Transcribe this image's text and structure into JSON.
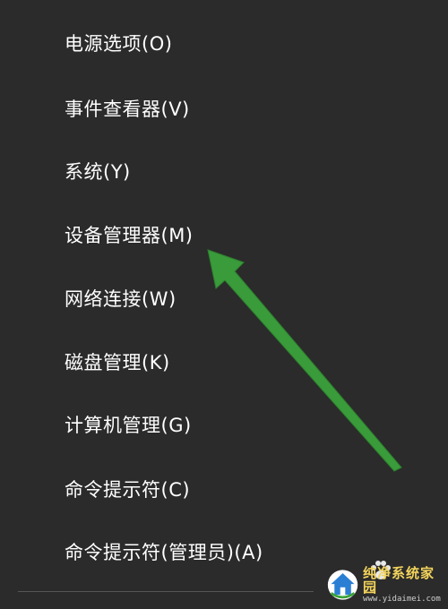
{
  "menu": {
    "items": [
      {
        "label": "电源选项(O)"
      },
      {
        "label": "事件查看器(V)"
      },
      {
        "label": "系统(Y)"
      },
      {
        "label": "设备管理器(M)"
      },
      {
        "label": "网络连接(W)"
      },
      {
        "label": "磁盘管理(K)"
      },
      {
        "label": "计算机管理(G)"
      },
      {
        "label": "命令提示符(C)"
      },
      {
        "label": "命令提示符(管理员)(A)"
      }
    ]
  },
  "annotation": {
    "arrow_color": "#3a9b3a",
    "arrow_target": "设备管理器(M)"
  },
  "watermark": {
    "title": "纯净系统家园",
    "url": "www.yidaimei.com",
    "logo_icon": "house-logo-icon",
    "paw_icon": "paw-icon"
  },
  "colors": {
    "background": "#2b2b2b",
    "text": "#ffffff",
    "divider": "#555555"
  }
}
